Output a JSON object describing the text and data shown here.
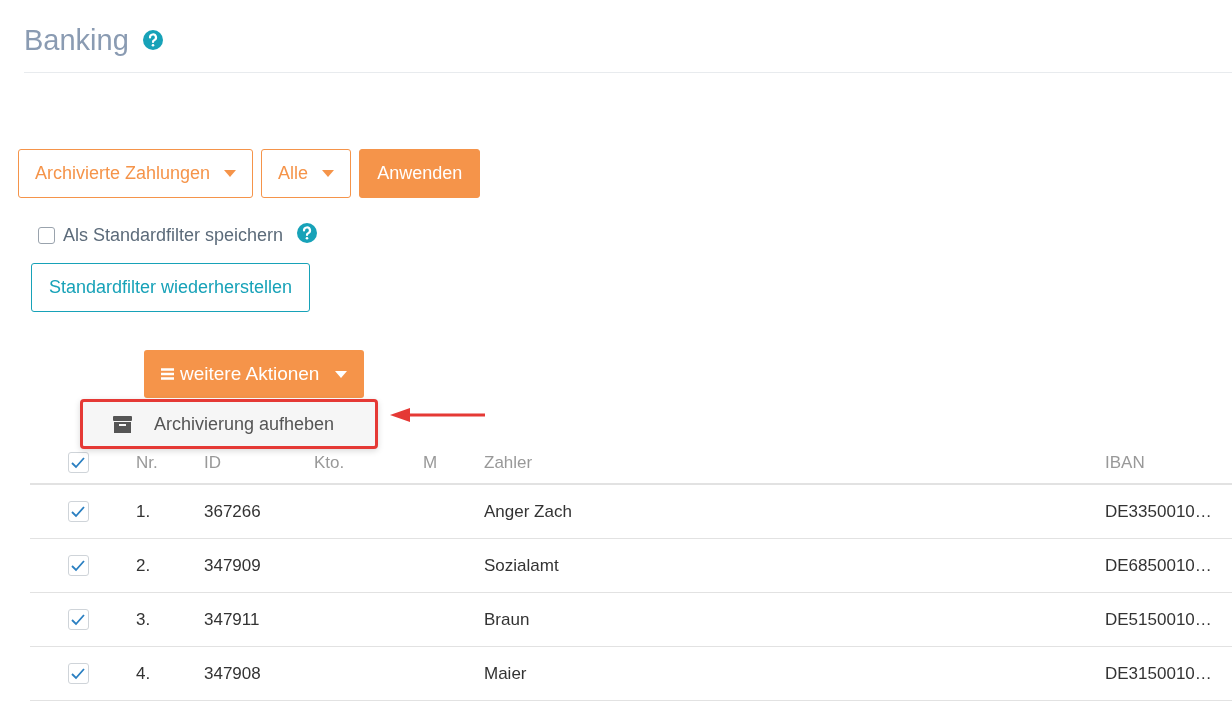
{
  "page": {
    "title": "Banking"
  },
  "filters": {
    "dropdowns": [
      {
        "label": "Archivierte Zahlungen"
      },
      {
        "label": "Alle"
      }
    ],
    "apply_button": "Anwenden",
    "save_default": {
      "label": "Als Standardfilter speichern",
      "checked": false
    },
    "restore_button": "Standardfilter wiederherstellen"
  },
  "actions": {
    "button": "weitere Aktionen",
    "menu_items": [
      {
        "label": "Archivierung aufheben",
        "highlighted": true
      }
    ]
  },
  "table": {
    "select_all_checked": true,
    "columns": [
      "Nr.",
      "ID",
      "Kto.",
      "M",
      "Zahler",
      "IBAN"
    ],
    "rows": [
      {
        "checked": true,
        "cells": [
          "1.",
          "367266",
          "",
          "",
          "Anger Zach",
          "DE3350010…"
        ]
      },
      {
        "checked": true,
        "cells": [
          "2.",
          "347909",
          "",
          "",
          "Sozialamt",
          "DE6850010…"
        ]
      },
      {
        "checked": true,
        "cells": [
          "3.",
          "347911",
          "",
          "",
          "Braun",
          "DE5150010…"
        ]
      },
      {
        "checked": true,
        "cells": [
          "4.",
          "347908",
          "",
          "",
          "Maier",
          "DE3150010…"
        ]
      }
    ]
  }
}
